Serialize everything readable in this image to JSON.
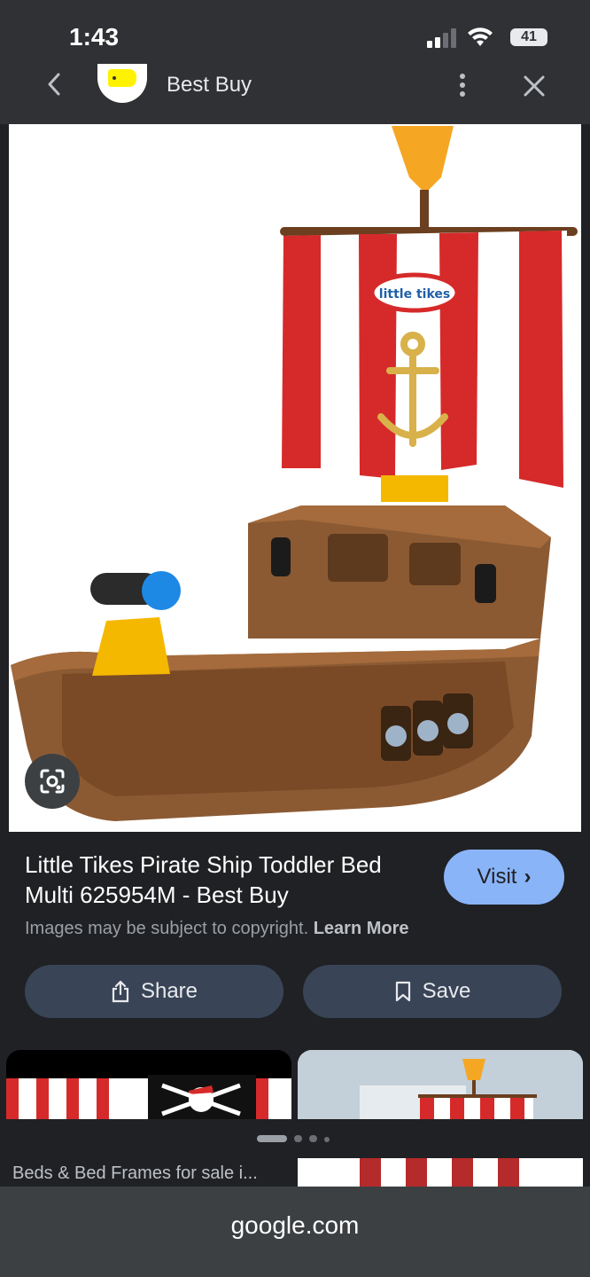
{
  "status_bar": {
    "time": "1:43",
    "battery": "41"
  },
  "nav": {
    "site_name": "Best Buy"
  },
  "result": {
    "title": "Little Tikes Pirate Ship Toddler Bed Multi 625954M - Best Buy",
    "visit_label": "Visit",
    "copyright_text": "Images may be subject to copyright.",
    "learn_more": "Learn More"
  },
  "actions": {
    "share_label": "Share",
    "save_label": "Save"
  },
  "image": {
    "sail_logo_text": "little tikes"
  },
  "related": {
    "caption": "Beds & Bed Frames for sale i..."
  },
  "url_bar": {
    "url": "google.com"
  },
  "colors": {
    "accent": "#8ab4f8",
    "background": "#202124",
    "pill": "#394457"
  }
}
